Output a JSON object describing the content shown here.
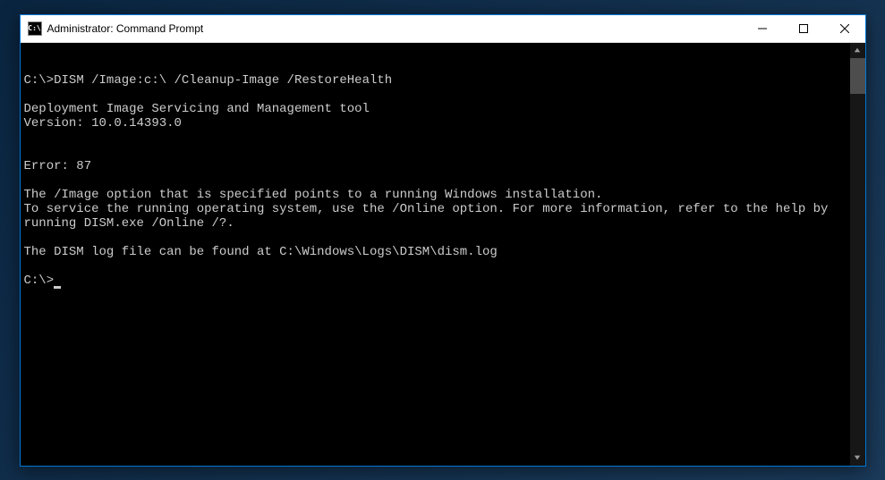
{
  "window": {
    "title": "Administrator: Command Prompt",
    "icon_label": "C:\\"
  },
  "terminal": {
    "line1_prompt": "C:\\>",
    "line1_command": "DISM /Image:c:\\ /Cleanup-Image /RestoreHealth",
    "line2": "",
    "line3": "Deployment Image Servicing and Management tool",
    "line4": "Version: 10.0.14393.0",
    "line5": "",
    "line6": "",
    "line7": "Error: 87",
    "line8": "",
    "line9": "The /Image option that is specified points to a running Windows installation.",
    "line10": "To service the running operating system, use the /Online option. For more information, refer to the help by running DISM.exe /Online /?.",
    "line11": "",
    "line12": "The DISM log file can be found at C:\\Windows\\Logs\\DISM\\dism.log",
    "line13": "",
    "line14_prompt": "C:\\>"
  }
}
